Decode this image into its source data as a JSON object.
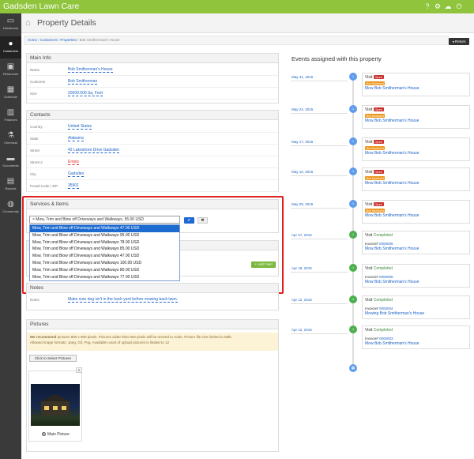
{
  "app": {
    "title": "Gadsden Lawn Care"
  },
  "sidebar": [
    {
      "label": "Dashboard",
      "icon": "monitor-icon",
      "glyph": "▭"
    },
    {
      "label": "Customers",
      "icon": "user-icon",
      "glyph": "●"
    },
    {
      "label": "Resources",
      "icon": "box-icon",
      "glyph": "▣"
    },
    {
      "label": "Schedule",
      "icon": "calendar-icon",
      "glyph": "▦"
    },
    {
      "label": "Finances",
      "icon": "book-icon",
      "glyph": "▥"
    },
    {
      "label": "Chemical",
      "icon": "flask-icon",
      "glyph": "⚗"
    },
    {
      "label": "Documents",
      "icon": "folder-icon",
      "glyph": "▬"
    },
    {
      "label": "Reports",
      "icon": "bar-chart-icon",
      "glyph": "▤"
    },
    {
      "label": "Community",
      "icon": "chat-icon",
      "glyph": "◍"
    }
  ],
  "page": {
    "title": "Property Details",
    "return_label": "Return"
  },
  "breadcrumb": {
    "home": "Home",
    "customers": "Customers",
    "properties": "Properties",
    "current": "Bob Smitherman's House"
  },
  "main_info": {
    "heading": "Main Info",
    "rows": [
      {
        "label": "Name",
        "value": "Bob Smitherman's House"
      },
      {
        "label": "Customer",
        "value": "Bob Smitherman"
      },
      {
        "label": "Size",
        "value": "20000.000 Sq. Feet"
      }
    ]
  },
  "contacts": {
    "heading": "Contacts",
    "rows": [
      {
        "label": "Country",
        "value": "United States"
      },
      {
        "label": "State",
        "value": "Alabama"
      },
      {
        "label": "Street",
        "value": "42 Lakeshore Drive Gadsden"
      },
      {
        "label": "Street 2",
        "value": "Empty"
      },
      {
        "label": "City",
        "value": "Gadsden"
      },
      {
        "label": "Postal Code / ZIP",
        "value": "35901"
      }
    ]
  },
  "services": {
    "heading": "Services & Items",
    "selected": "× Mow, Trim and Blow off Driveways and Walkways, 55.00 USD",
    "options": [
      "Mow, Trim and Blow off Driveways and Walkways 47.00 USD",
      "Mow, Trim and Blow off Driveways and Walkways 95.00 USD",
      "Mow, Trim and Blow off Driveways and Walkways 78.00 USD",
      "Mow, Trim and Blow off Driveways and Walkways 85.00 USD",
      "Mow, Trim and Blow off Driveways and Walkways 47.00 USD",
      "Mow, Trim and Blow off Driveways and Walkways 100.00 USD",
      "Mow, Trim and Blow off Driveways and Walkways 80.00 USD",
      "Mow, Trim and Blow off Driveways and Walkways 77.00 USD"
    ],
    "ok": "✔",
    "cancel": "✖",
    "add_field": "+ Add Field"
  },
  "notes": {
    "heading": "Notes",
    "label": "Notes",
    "value": "Make sure dog isn't in the back yard before mowing back lawn."
  },
  "pictures": {
    "heading": "Pictures",
    "recommend_bold": "We recommend",
    "recommend_text": " pictures 800 x 800 pixels. Pictures wider than 800 pixels will be resized to scale. Picture file size limited to 5Mb.",
    "formats": "Allowed image formats: Jpeg, Gif, Png. Available count of upload pictures is limited to 12",
    "select_label": "Click to Select Pictures",
    "remove": "×",
    "main_label": "Main Picture"
  },
  "events": {
    "heading": "Events assigned with this property",
    "items": [
      {
        "date": "May 31, 2015",
        "kind": "Visit",
        "status": "Open",
        "billing": "Not Invoiced",
        "link": "Mow Bob Smitherman's House",
        "icon": "home-icon"
      },
      {
        "date": "May 24, 2015",
        "kind": "Visit",
        "status": "Open",
        "billing": "Not Invoiced",
        "link": "Mow Bob Smitherman's House",
        "icon": "home-icon"
      },
      {
        "date": "May 17, 2015",
        "kind": "Visit",
        "status": "Open",
        "billing": "Not Invoiced",
        "link": "Mow Bob Smitherman's House",
        "icon": "home-icon"
      },
      {
        "date": "May 10, 2015",
        "kind": "Visit",
        "status": "Open",
        "billing": "Not Invoiced",
        "link": "Mow Bob Smitherman's House",
        "icon": "home-icon"
      },
      {
        "date": "May 09, 2015",
        "kind": "Visit",
        "status": "Open",
        "billing": "Not Invoiced",
        "link": "Mow Bob Smitherman's House",
        "icon": "home-icon"
      },
      {
        "date": "Apr 27, 2015",
        "kind": "Visit",
        "status": "Completed",
        "invoice_label": "Invoice#",
        "invoice": "0000006",
        "link": "Mow Bob Smitherman's House",
        "icon": "home-icon"
      },
      {
        "date": "Apr 18, 2015",
        "kind": "Visit",
        "status": "Completed",
        "invoice_label": "Invoice#",
        "invoice": "0000006",
        "link": "Mow Bob Smitherman's House",
        "icon": "home-icon"
      },
      {
        "date": "Apr 12, 2015",
        "kind": "Visit",
        "status": "Completed",
        "invoice_label": "Invoice#",
        "invoice": "0000004",
        "link": "Mowing Bob Smitherman's House",
        "icon": "home-icon"
      },
      {
        "date": "Apr 12, 2015",
        "kind": "Visit",
        "status": "Completed",
        "invoice_label": "Invoice#",
        "invoice": "0000003",
        "link": "Mow Bob Smitherman's House",
        "icon": "home-icon"
      }
    ]
  },
  "colors": {
    "brand": "#8fc43c",
    "sidebar": "#3a3a3a",
    "link": "#1d62c5",
    "highlight": "#d22222"
  }
}
